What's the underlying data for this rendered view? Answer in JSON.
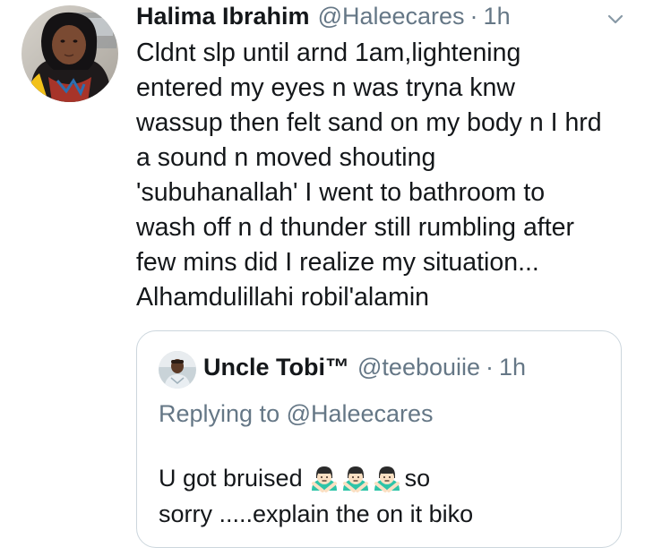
{
  "tweet": {
    "display_name": "Halima Ibrahim",
    "handle": "@Haleecares",
    "separator": "·",
    "time": "1h",
    "avatar_icon": "profile-photo",
    "menu_icon": "chevron-down-icon",
    "body_lines": [
      "Cldnt slp until arnd 1am,lightening",
      "entered my eyes n was tryna knw",
      "wassup then felt sand on my body n I hrd",
      "a sound n moved shouting",
      "'subuhanallah' I went to bathroom to",
      "wash off n d thunder still rumbling after",
      "few mins did I realize my situation...",
      "Alhamdulillahi robil'alamin"
    ]
  },
  "quoted_tweet": {
    "display_name": "Uncle Tobi™",
    "handle": "@teebouiie",
    "separator": "·",
    "time": "1h",
    "avatar_icon": "profile-photo",
    "replying_to": "Replying to @Haleecares",
    "body_line1_before": "U got bruised",
    "emoji_names": [
      "man-gesturing-no-emoji",
      "man-gesturing-no-emoji",
      "man-gesturing-no-emoji"
    ],
    "body_line1_after": "so",
    "body_line2": "sorry .....explain the on it biko"
  },
  "colors": {
    "text": "#14171a",
    "secondary": "#657786",
    "border": "#ccd6dd",
    "emoji_teal": "#2ec4a8"
  }
}
